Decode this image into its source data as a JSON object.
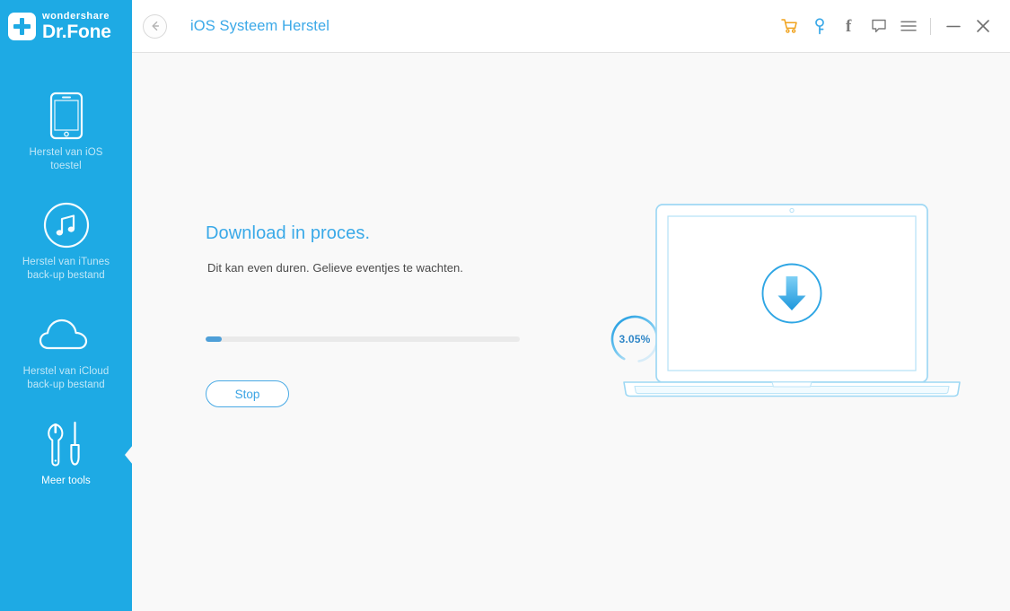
{
  "app": {
    "brand_small": "wondershare",
    "brand_main": "Dr.Fone",
    "logo_icon": "dr-fone-cross-logo",
    "accent_blue": "#1eaae4",
    "title_blue": "#3ba9e8",
    "cart_orange": "#f0a21c",
    "key_blue": "#3ba9e8"
  },
  "titlebar": {
    "back_icon": "back-arrow-icon",
    "title": "iOS Systeem Herstel",
    "icons": [
      {
        "name": "cart-icon",
        "glyph": "cart"
      },
      {
        "name": "key-icon",
        "glyph": "key"
      },
      {
        "name": "facebook-icon",
        "glyph": "f"
      },
      {
        "name": "feedback-icon",
        "glyph": "speech-bubble"
      },
      {
        "name": "menu-icon",
        "glyph": "hamburger"
      }
    ],
    "minimize_label": "minimize-icon",
    "close_label": "close-icon"
  },
  "sidebar": {
    "items": [
      {
        "label": "Herstel van iOS\ntoestel",
        "icon": "phone-icon",
        "active": false
      },
      {
        "label": "Herstel van iTunes\nback-up bestand",
        "icon": "itunes-music-note-icon",
        "active": false
      },
      {
        "label": "Herstel van iCloud\nback-up bestand",
        "icon": "cloud-icon",
        "active": false
      },
      {
        "label": "Meer tools",
        "icon": "wrench-screwdriver-icon",
        "active": true
      }
    ]
  },
  "main": {
    "headline": "Download in proces.",
    "subline": "Dit kan even duren. Gelieve eventjes te wachten.",
    "progress_percent_label": "3.05%",
    "progress_percent_value": 3.05,
    "stop_label": "Stop",
    "illustration": "laptop-with-download-arrow"
  }
}
